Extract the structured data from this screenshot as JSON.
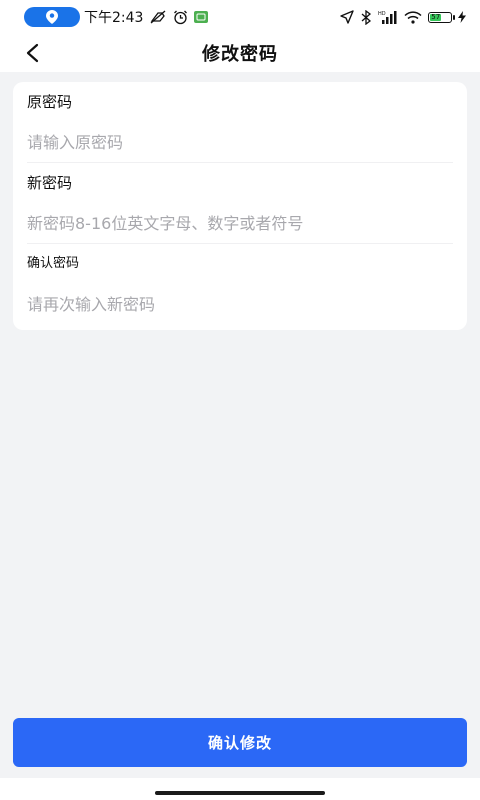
{
  "status_bar": {
    "time": "下午2:43",
    "battery_level": "57",
    "signal_label": "HD",
    "colors": {
      "location_pill": "#1a73e8",
      "battery": "#35c759",
      "notification": "#4caf50"
    }
  },
  "nav": {
    "title": "修改密码"
  },
  "form": {
    "old_password": {
      "label": "原密码",
      "placeholder": "请输入原密码",
      "value": ""
    },
    "new_password": {
      "label": "新密码",
      "placeholder": "新密码8-16位英文字母、数字或者符号",
      "value": ""
    },
    "confirm_password": {
      "label": "确认密码",
      "placeholder": "请再次输入新密码",
      "value": ""
    }
  },
  "actions": {
    "confirm_label": "确认修改",
    "accent_color": "#2b68f6"
  }
}
